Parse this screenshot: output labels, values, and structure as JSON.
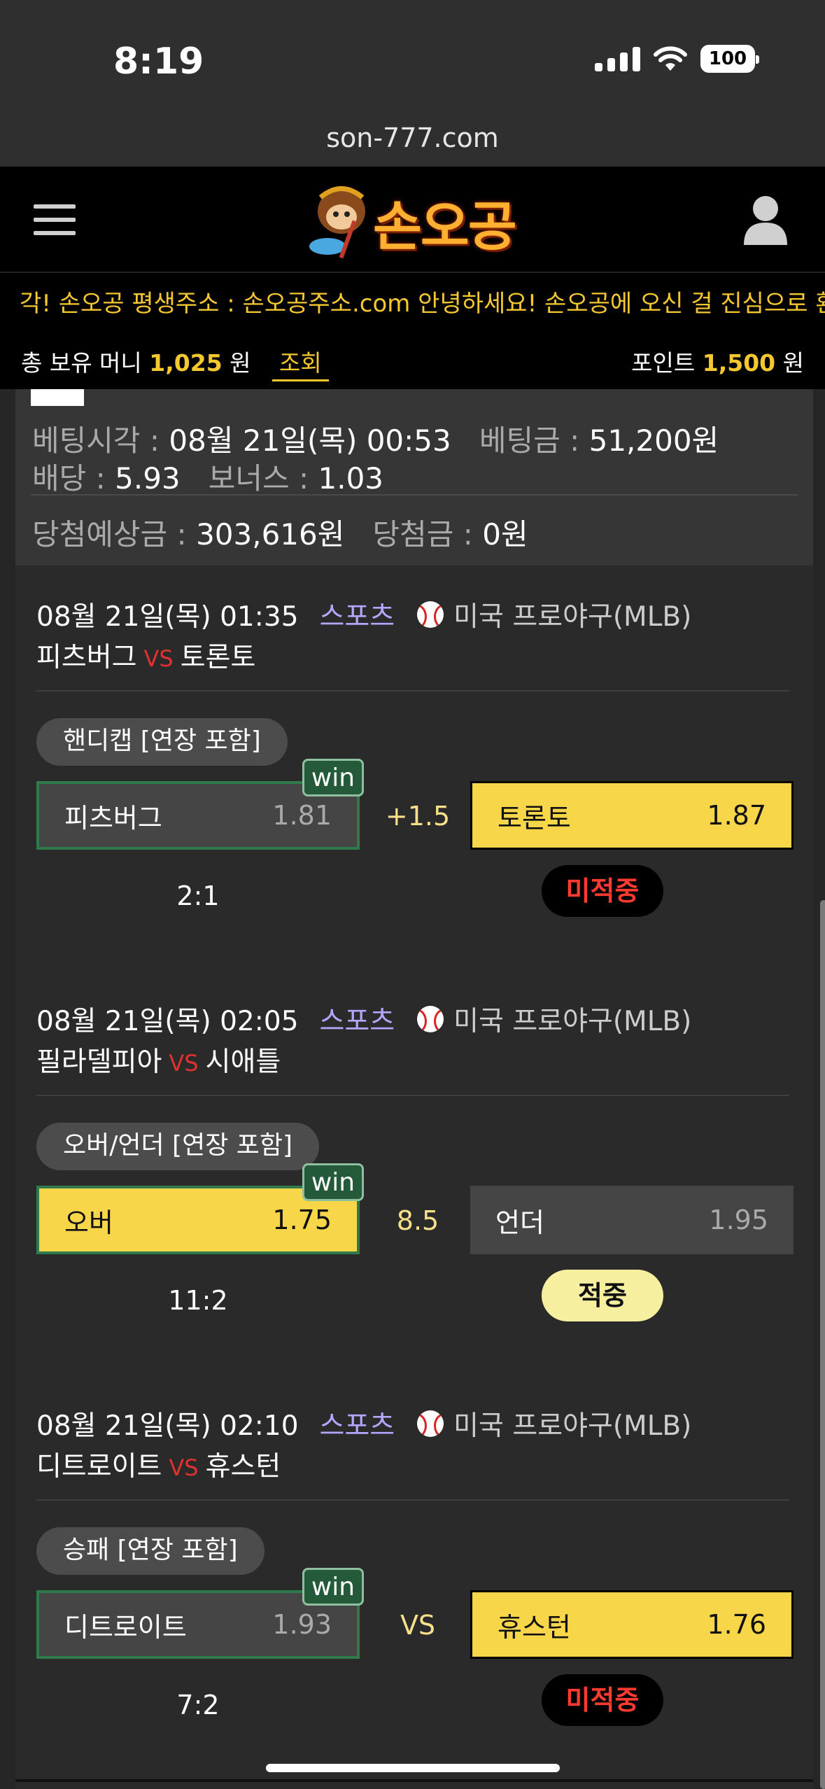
{
  "status_bar": {
    "time": "8:19",
    "battery": "100"
  },
  "browser": {
    "url": "son-777.com"
  },
  "header": {
    "brand": "손오공"
  },
  "marquee": {
    "text": "각! 손오공 평생주소 : 손오공주소.com   안녕하세요! 손오공에 오신 걸 진심으로 환영"
  },
  "money": {
    "label": "총 보유 머니",
    "amount": "1,025",
    "unit": "원",
    "check_label": "조회",
    "point_label": "포인트",
    "point_amount": "1,500",
    "point_unit": "원"
  },
  "summary": {
    "bet_time_label": "베팅시각 :",
    "bet_time": "08월 21일(목) 00:53",
    "bet_amount_label": "베팅금 :",
    "bet_amount": "51,200원",
    "odds_label": "배당 :",
    "odds": "5.93",
    "bonus_label": "보너스 :",
    "bonus": "1.03",
    "expected_label": "당첨예상금 :",
    "expected": "303,616원",
    "won_label": "당첨금 :",
    "won": "0원"
  },
  "games": [
    {
      "datetime": "08월 21일(목) 01:35",
      "sport": "스포츠",
      "league": "미국 프로야구(MLB)",
      "home": "피츠버그",
      "vs": "VS",
      "away": "토론토",
      "market": "핸디캡 [연장 포함]",
      "left_name": "피츠버그",
      "left_odds": "1.81",
      "left_win": "win",
      "center": "+1.5",
      "right_name": "토론토",
      "right_odds": "1.87",
      "score": "2:1",
      "result": "미적중"
    },
    {
      "datetime": "08월 21일(목) 02:05",
      "sport": "스포츠",
      "league": "미국 프로야구(MLB)",
      "home": "필라델피아",
      "vs": "VS",
      "away": "시애틀",
      "market": "오버/언더 [연장 포함]",
      "left_name": "오버",
      "left_odds": "1.75",
      "left_win": "win",
      "center": "8.5",
      "right_name": "언더",
      "right_odds": "1.95",
      "score": "11:2",
      "result": "적중"
    },
    {
      "datetime": "08월 21일(목) 02:10",
      "sport": "스포츠",
      "league": "미국 프로야구(MLB)",
      "home": "디트로이트",
      "vs": "VS",
      "away": "휴스턴",
      "market": "승패 [연장 포함]",
      "left_name": "디트로이트",
      "left_odds": "1.93",
      "left_win": "win",
      "center": "VS",
      "right_name": "휴스턴",
      "right_odds": "1.76",
      "score": "7:2",
      "result": "미적중"
    }
  ],
  "colors": {
    "accent": "#f5c830",
    "selected": "#f7d64a",
    "win_badge": "#24593a",
    "miss": "#ff3b2f",
    "sport": "#b4a6ff"
  }
}
